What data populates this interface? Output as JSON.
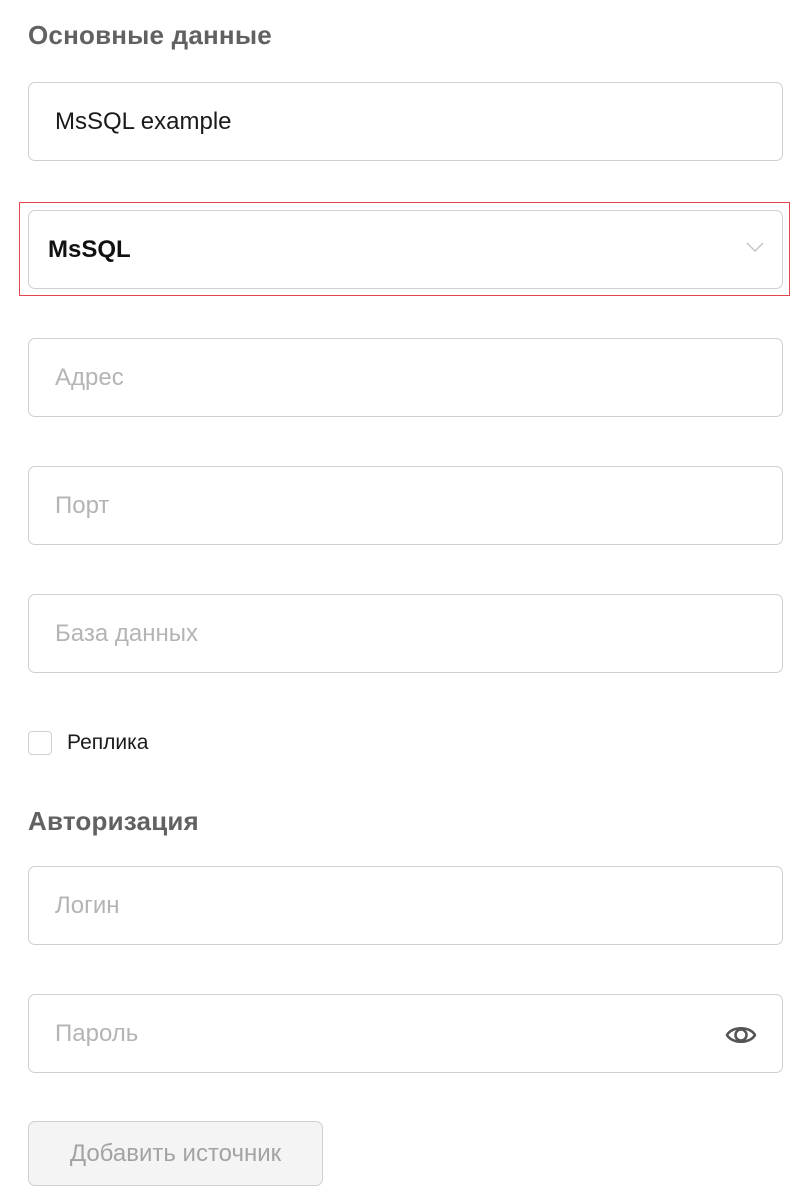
{
  "main": {
    "title": "Основные данные",
    "name_field": {
      "value": "MsSQL example"
    },
    "db_type_select": {
      "selected": "MsSQL",
      "icon": "chevron-down-icon"
    },
    "address_field": {
      "placeholder": "Адрес"
    },
    "port_field": {
      "placeholder": "Порт"
    },
    "database_field": {
      "placeholder": "База данных"
    },
    "replica_checkbox": {
      "label": "Реплика",
      "checked": false
    }
  },
  "auth": {
    "title": "Авторизация",
    "login_field": {
      "placeholder": "Логин"
    },
    "password_field": {
      "placeholder": "Пароль",
      "icon": "eye-icon"
    }
  },
  "actions": {
    "submit_label": "Добавить источник"
  },
  "colors": {
    "border": "#cfcfcf",
    "placeholder": "#b4b4b4",
    "heading": "#616161",
    "highlight": "#e0464e",
    "disabled_text": "#a3a3a3",
    "disabled_bg": "#f4f4f4"
  }
}
